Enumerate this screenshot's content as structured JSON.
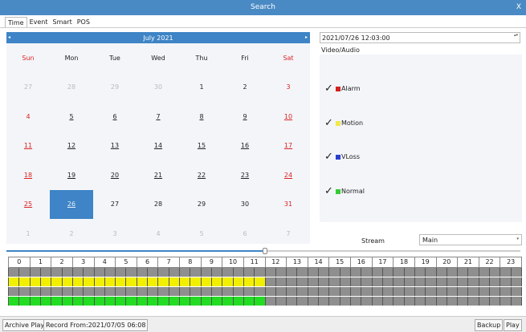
{
  "window": {
    "title": "Search",
    "close_label": "X"
  },
  "tabs": [
    {
      "label": "Time",
      "active": true
    },
    {
      "label": "Event",
      "active": false
    },
    {
      "label": "Smart",
      "active": false
    },
    {
      "label": "POS",
      "active": false
    }
  ],
  "calendar": {
    "month_label": "July  2021",
    "prev_icon": "◂",
    "next_icon": "▸",
    "weekdays": [
      "Sun",
      "Mon",
      "Tue",
      "Wed",
      "Thu",
      "Fri",
      "Sat"
    ],
    "days": [
      {
        "label": "27",
        "muted": true
      },
      {
        "label": "28",
        "muted": true
      },
      {
        "label": "29",
        "muted": true
      },
      {
        "label": "30",
        "muted": true
      },
      {
        "label": "1"
      },
      {
        "label": "2"
      },
      {
        "label": "3"
      },
      {
        "label": "4"
      },
      {
        "label": "5",
        "rec": true
      },
      {
        "label": "6",
        "rec": true
      },
      {
        "label": "7",
        "rec": true
      },
      {
        "label": "8",
        "rec": true
      },
      {
        "label": "9",
        "rec": true
      },
      {
        "label": "10",
        "rec": true
      },
      {
        "label": "11",
        "rec": true
      },
      {
        "label": "12",
        "rec": true
      },
      {
        "label": "13",
        "rec": true
      },
      {
        "label": "14",
        "rec": true
      },
      {
        "label": "15",
        "rec": true
      },
      {
        "label": "16",
        "rec": true
      },
      {
        "label": "17",
        "rec": true
      },
      {
        "label": "18",
        "rec": true
      },
      {
        "label": "19",
        "rec": true
      },
      {
        "label": "20",
        "rec": true
      },
      {
        "label": "21",
        "rec": true
      },
      {
        "label": "22",
        "rec": true
      },
      {
        "label": "23",
        "rec": true
      },
      {
        "label": "24",
        "rec": true
      },
      {
        "label": "25",
        "rec": true
      },
      {
        "label": "26",
        "rec": true,
        "selected": true
      },
      {
        "label": "27"
      },
      {
        "label": "28"
      },
      {
        "label": "29"
      },
      {
        "label": "30"
      },
      {
        "label": "31"
      },
      {
        "label": "1",
        "muted": true
      },
      {
        "label": "2",
        "muted": true
      },
      {
        "label": "3",
        "muted": true
      },
      {
        "label": "4",
        "muted": true
      },
      {
        "label": "5",
        "muted": true
      },
      {
        "label": "6",
        "muted": true
      },
      {
        "label": "7",
        "muted": true
      }
    ]
  },
  "search": {
    "datetime_value": "2021/07/26 12:03:00",
    "datetime_spin_icon": "▴▾",
    "video_audio_label": "Video/Audio",
    "check_icon": "✓",
    "types": [
      {
        "label": "Alarm",
        "color": "#d42020",
        "checked": true
      },
      {
        "label": "Motion",
        "color": "#f2e84a",
        "checked": true
      },
      {
        "label": "VLoss",
        "color": "#2a3fd0",
        "checked": true
      },
      {
        "label": "Normal",
        "color": "#33cc33",
        "checked": true
      }
    ],
    "stream_label": "Stream",
    "stream_value": "Main",
    "stream_arrow_icon": "▾"
  },
  "timeline": {
    "hours": [
      "0",
      "1",
      "2",
      "3",
      "4",
      "5",
      "6",
      "7",
      "8",
      "9",
      "10",
      "11",
      "12",
      "13",
      "14",
      "15",
      "16",
      "17",
      "18",
      "19",
      "20",
      "21",
      "22",
      "23"
    ],
    "playhead_fraction": 0.503,
    "segments_per_hour": 2,
    "recorded_until_hour": 12,
    "rows": [
      {
        "fill": "none"
      },
      {
        "fill": "#f2f000"
      },
      {
        "fill": "none"
      },
      {
        "fill": "#22dd22"
      }
    ],
    "empty_color": "#8f8f8f"
  },
  "statusbar": {
    "archive_play_label": "Archive Play",
    "record_from_text": "Record From:2021/07/05 06:08",
    "backup_label": "Backup",
    "play_label": "Play"
  }
}
